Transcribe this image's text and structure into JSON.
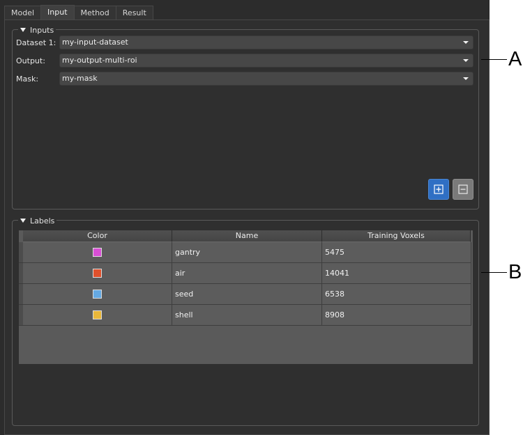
{
  "tabs": [
    {
      "label": "Model",
      "active": false
    },
    {
      "label": "Input",
      "active": true
    },
    {
      "label": "Method",
      "active": false
    },
    {
      "label": "Result",
      "active": false
    }
  ],
  "inputs": {
    "title": "Inputs",
    "rows": [
      {
        "label": "Dataset 1:",
        "value": "my-input-dataset"
      },
      {
        "label": "Output:",
        "value": "my-output-multi-roi"
      },
      {
        "label": "Mask:",
        "value": "my-mask"
      }
    ],
    "add_icon": "plus-square-icon",
    "remove_icon": "minus-square-icon"
  },
  "labels": {
    "title": "Labels",
    "columns": [
      "Color",
      "Name",
      "Training Voxels"
    ],
    "rows": [
      {
        "color": "#d94fd6",
        "name": "gantry",
        "voxels": "5475"
      },
      {
        "color": "#e0512d",
        "name": "air",
        "voxels": "14041"
      },
      {
        "color": "#65a9e2",
        "name": "seed",
        "voxels": "6538"
      },
      {
        "color": "#e9b73a",
        "name": "shell",
        "voxels": "8908"
      }
    ]
  },
  "callouts": {
    "a": "A",
    "b": "B"
  },
  "colors": {
    "window_bg": "#2c2c2c",
    "add_button": "#2f6fc4",
    "remove_button": "#7a7a7a"
  }
}
